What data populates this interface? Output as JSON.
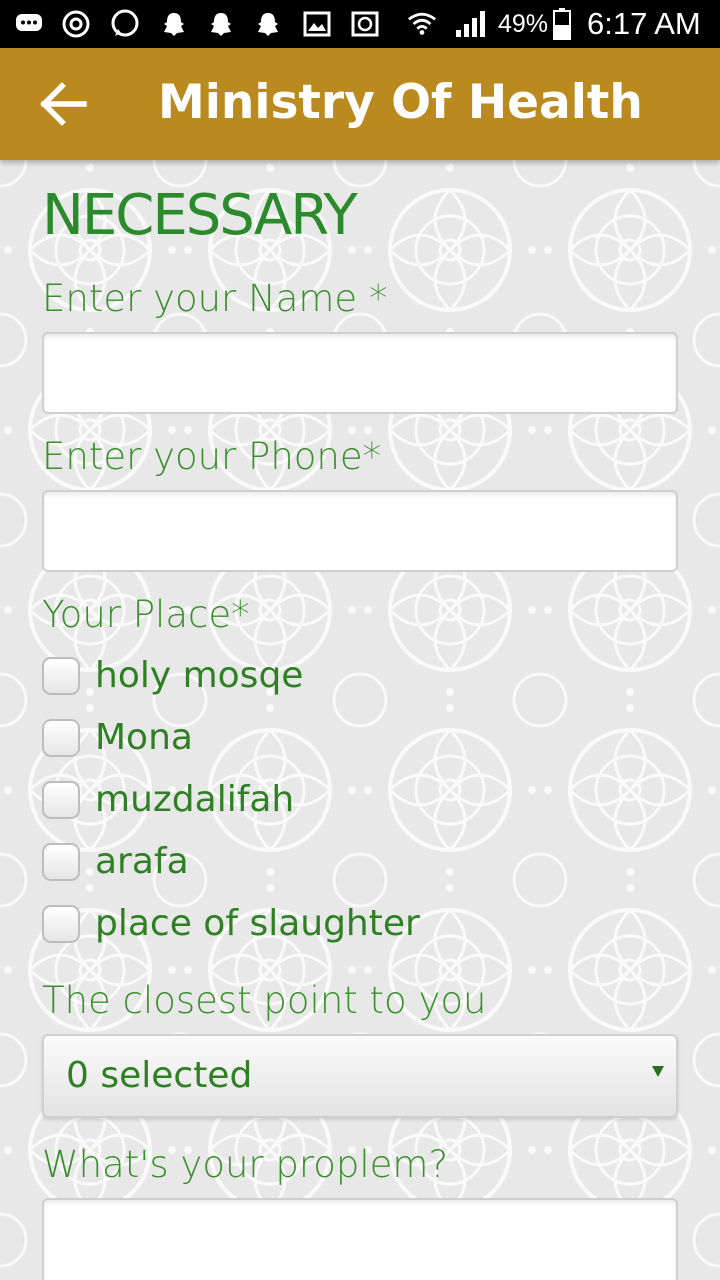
{
  "status_bar": {
    "battery": "49%",
    "time": "6:17 AM",
    "icons": [
      "messenger-icon",
      "sync-icon",
      "whatsapp-icon",
      "snapchat-icon",
      "snapchat-icon",
      "snapchat-icon",
      "gallery-icon",
      "money-icon",
      "wifi-icon",
      "signal-icon",
      "battery-icon"
    ]
  },
  "app_bar": {
    "title": "Ministry Of Health",
    "back_icon": "arrow-left-icon",
    "color": "#bb8a1f"
  },
  "form": {
    "section_title": "NECESSARY",
    "name_label": "Enter your Name *",
    "name_value": "",
    "phone_label": "Enter your Phone*",
    "phone_value": "",
    "place_label": "Your Place*",
    "places": [
      {
        "label": "holy mosqe",
        "checked": false
      },
      {
        "label": "Mona",
        "checked": false
      },
      {
        "label": "muzdalifah",
        "checked": false
      },
      {
        "label": "arafa",
        "checked": false
      },
      {
        "label": "place of slaughter",
        "checked": false
      }
    ],
    "closest_label": "The closest point to you",
    "closest_value": "0 selected",
    "problem_label": "What's your proplem?",
    "problem_value": ""
  },
  "colors": {
    "label_green": "#3a8f2c",
    "title_green": "#2b8a2b"
  }
}
